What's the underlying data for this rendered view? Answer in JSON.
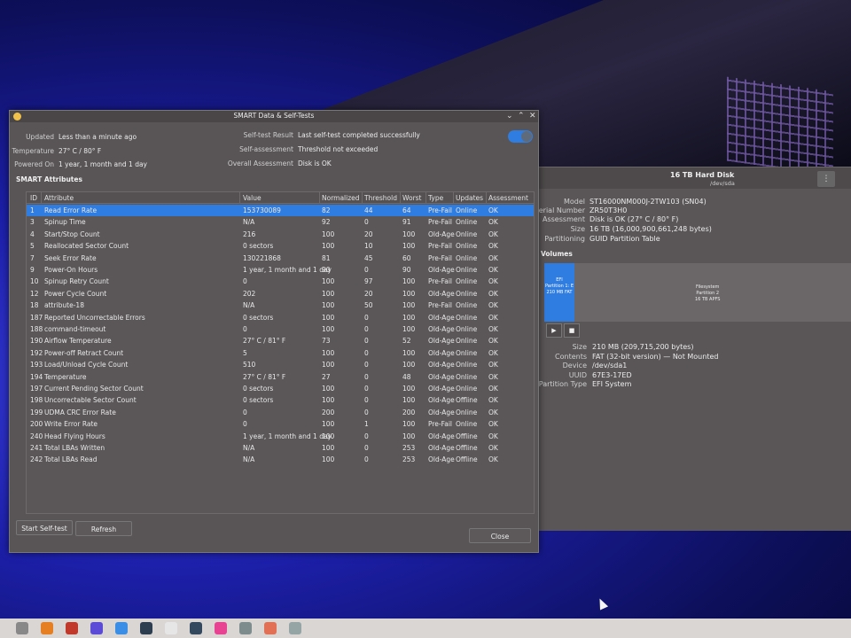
{
  "back_window": {
    "title": "16 TB Hard Disk",
    "subtitle": "/dev/sda",
    "menu_glyph": "⋮",
    "disk_info": [
      {
        "k": "Model",
        "v": "ST16000NM000J-2TW103 (SN04)"
      },
      {
        "k": "Serial Number",
        "v": "ZR50T3H0"
      },
      {
        "k": "Assessment",
        "v": "Disk is OK (27° C / 80° F)"
      },
      {
        "k": "Size",
        "v": "16 TB (16,000,900,661,248 bytes)"
      },
      {
        "k": "Partitioning",
        "v": "GUID Partition Table"
      }
    ],
    "volumes_title": "Volumes",
    "efi_label": [
      "EFI",
      "Partition 1: E",
      "210 MB FAT"
    ],
    "apfs_label": [
      "Filesystem",
      "Partition 2",
      "16 TB APFS"
    ],
    "play_glyph": "▶",
    "stop_glyph": "■",
    "partition_info": [
      {
        "k": "Size",
        "v": "210 MB (209,715,200 bytes)"
      },
      {
        "k": "Contents",
        "v": "FAT (32-bit version) — Not Mounted"
      },
      {
        "k": "Device",
        "v": "/dev/sda1"
      },
      {
        "k": "UUID",
        "v": "67E3-17ED"
      },
      {
        "k": "Partition Type",
        "v": "EFI System"
      }
    ]
  },
  "dialog": {
    "title": "SMART Data & Self-Tests",
    "controls": {
      "minimize": "⌄",
      "maximize": "⌃",
      "close": "✕"
    },
    "summary": {
      "updated_label": "Updated",
      "updated_value": "Less than a minute ago",
      "temperature_label": "Temperature",
      "temperature_value": "27° C / 80° F",
      "powered_on_label": "Powered On",
      "powered_on_value": "1 year, 1 month and 1 day",
      "selftest_label": "Self-test Result",
      "selftest_value": "Last self-test completed successfully",
      "selfassess_label": "Self-assessment",
      "selfassess_value": "Threshold not exceeded",
      "overall_label": "Overall Assessment",
      "overall_value": "Disk is OK"
    },
    "smart_enabled": true,
    "section_title": "SMART Attributes",
    "columns": [
      "ID",
      "Attribute",
      "Value",
      "Normalized",
      "Threshold",
      "Worst",
      "Type",
      "Updates",
      "Assessment"
    ],
    "rows": [
      [
        "1",
        "Read Error Rate",
        "153730089",
        "82",
        "44",
        "64",
        "Pre-Fail",
        "Online",
        "OK"
      ],
      [
        "3",
        "Spinup Time",
        "N/A",
        "92",
        "0",
        "91",
        "Pre-Fail",
        "Online",
        "OK"
      ],
      [
        "4",
        "Start/Stop Count",
        "216",
        "100",
        "20",
        "100",
        "Old-Age",
        "Online",
        "OK"
      ],
      [
        "5",
        "Reallocated Sector Count",
        "0 sectors",
        "100",
        "10",
        "100",
        "Pre-Fail",
        "Online",
        "OK"
      ],
      [
        "7",
        "Seek Error Rate",
        "130221868",
        "81",
        "45",
        "60",
        "Pre-Fail",
        "Online",
        "OK"
      ],
      [
        "9",
        "Power-On Hours",
        "1 year, 1 month and 1 day",
        "90",
        "0",
        "90",
        "Old-Age",
        "Online",
        "OK"
      ],
      [
        "10",
        "Spinup Retry Count",
        "0",
        "100",
        "97",
        "100",
        "Pre-Fail",
        "Online",
        "OK"
      ],
      [
        "12",
        "Power Cycle Count",
        "202",
        "100",
        "20",
        "100",
        "Old-Age",
        "Online",
        "OK"
      ],
      [
        "18",
        "attribute-18",
        "N/A",
        "100",
        "50",
        "100",
        "Pre-Fail",
        "Online",
        "OK"
      ],
      [
        "187",
        "Reported Uncorrectable Errors",
        "0 sectors",
        "100",
        "0",
        "100",
        "Old-Age",
        "Online",
        "OK"
      ],
      [
        "188",
        "command-timeout",
        "0",
        "100",
        "0",
        "100",
        "Old-Age",
        "Online",
        "OK"
      ],
      [
        "190",
        "Airflow Temperature",
        "27° C / 81° F",
        "73",
        "0",
        "52",
        "Old-Age",
        "Online",
        "OK"
      ],
      [
        "192",
        "Power-off Retract Count",
        "5",
        "100",
        "0",
        "100",
        "Old-Age",
        "Online",
        "OK"
      ],
      [
        "193",
        "Load/Unload Cycle Count",
        "510",
        "100",
        "0",
        "100",
        "Old-Age",
        "Online",
        "OK"
      ],
      [
        "194",
        "Temperature",
        "27° C / 81° F",
        "27",
        "0",
        "48",
        "Old-Age",
        "Online",
        "OK"
      ],
      [
        "197",
        "Current Pending Sector Count",
        "0 sectors",
        "100",
        "0",
        "100",
        "Old-Age",
        "Online",
        "OK"
      ],
      [
        "198",
        "Uncorrectable Sector Count",
        "0 sectors",
        "100",
        "0",
        "100",
        "Old-Age",
        "Offline",
        "OK"
      ],
      [
        "199",
        "UDMA CRC Error Rate",
        "0",
        "200",
        "0",
        "200",
        "Old-Age",
        "Online",
        "OK"
      ],
      [
        "200",
        "Write Error Rate",
        "0",
        "100",
        "1",
        "100",
        "Pre-Fail",
        "Online",
        "OK"
      ],
      [
        "240",
        "Head Flying Hours",
        "1 year, 1 month and 1 day",
        "100",
        "0",
        "100",
        "Old-Age",
        "Offline",
        "OK"
      ],
      [
        "241",
        "Total LBAs Written",
        "N/A",
        "100",
        "0",
        "253",
        "Old-Age",
        "Offline",
        "OK"
      ],
      [
        "242",
        "Total LBAs Read",
        "N/A",
        "100",
        "0",
        "253",
        "Old-Age",
        "Offline",
        "OK"
      ]
    ],
    "selected_row": 0,
    "buttons": {
      "start": "Start Self-test",
      "refresh": "Refresh",
      "close": "Close"
    }
  },
  "colors": {
    "accent": "#2f7de1",
    "window_bg": "#595556",
    "taskbar": "#d9d6d4"
  },
  "taskbar_icons": [
    "settings-icon",
    "browser-icon",
    "gift-icon",
    "app-icon",
    "files-icon",
    "info-icon",
    "media-icon",
    "terminal-icon",
    "paint-icon",
    "grid-icon",
    "calendar-icon",
    "window-icon"
  ]
}
